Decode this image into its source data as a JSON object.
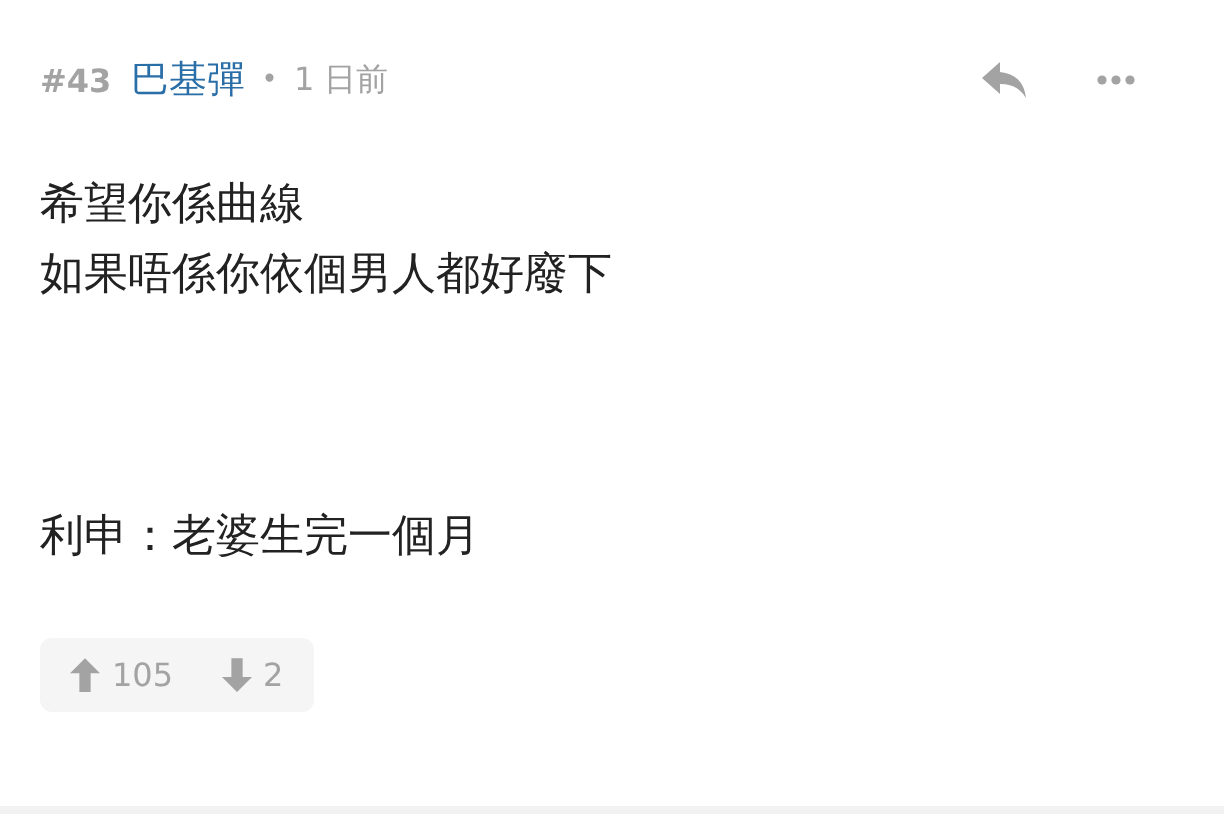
{
  "post": {
    "number": "#43",
    "author": "巴基彈",
    "separator": "•",
    "time": "1 日前",
    "paragraphs": [
      [
        "希望你係曲線",
        "如果唔係你依個男人都好廢下"
      ],
      [
        "利申：老婆生完一個月"
      ]
    ],
    "votes": {
      "up": "105",
      "down": "2"
    }
  }
}
